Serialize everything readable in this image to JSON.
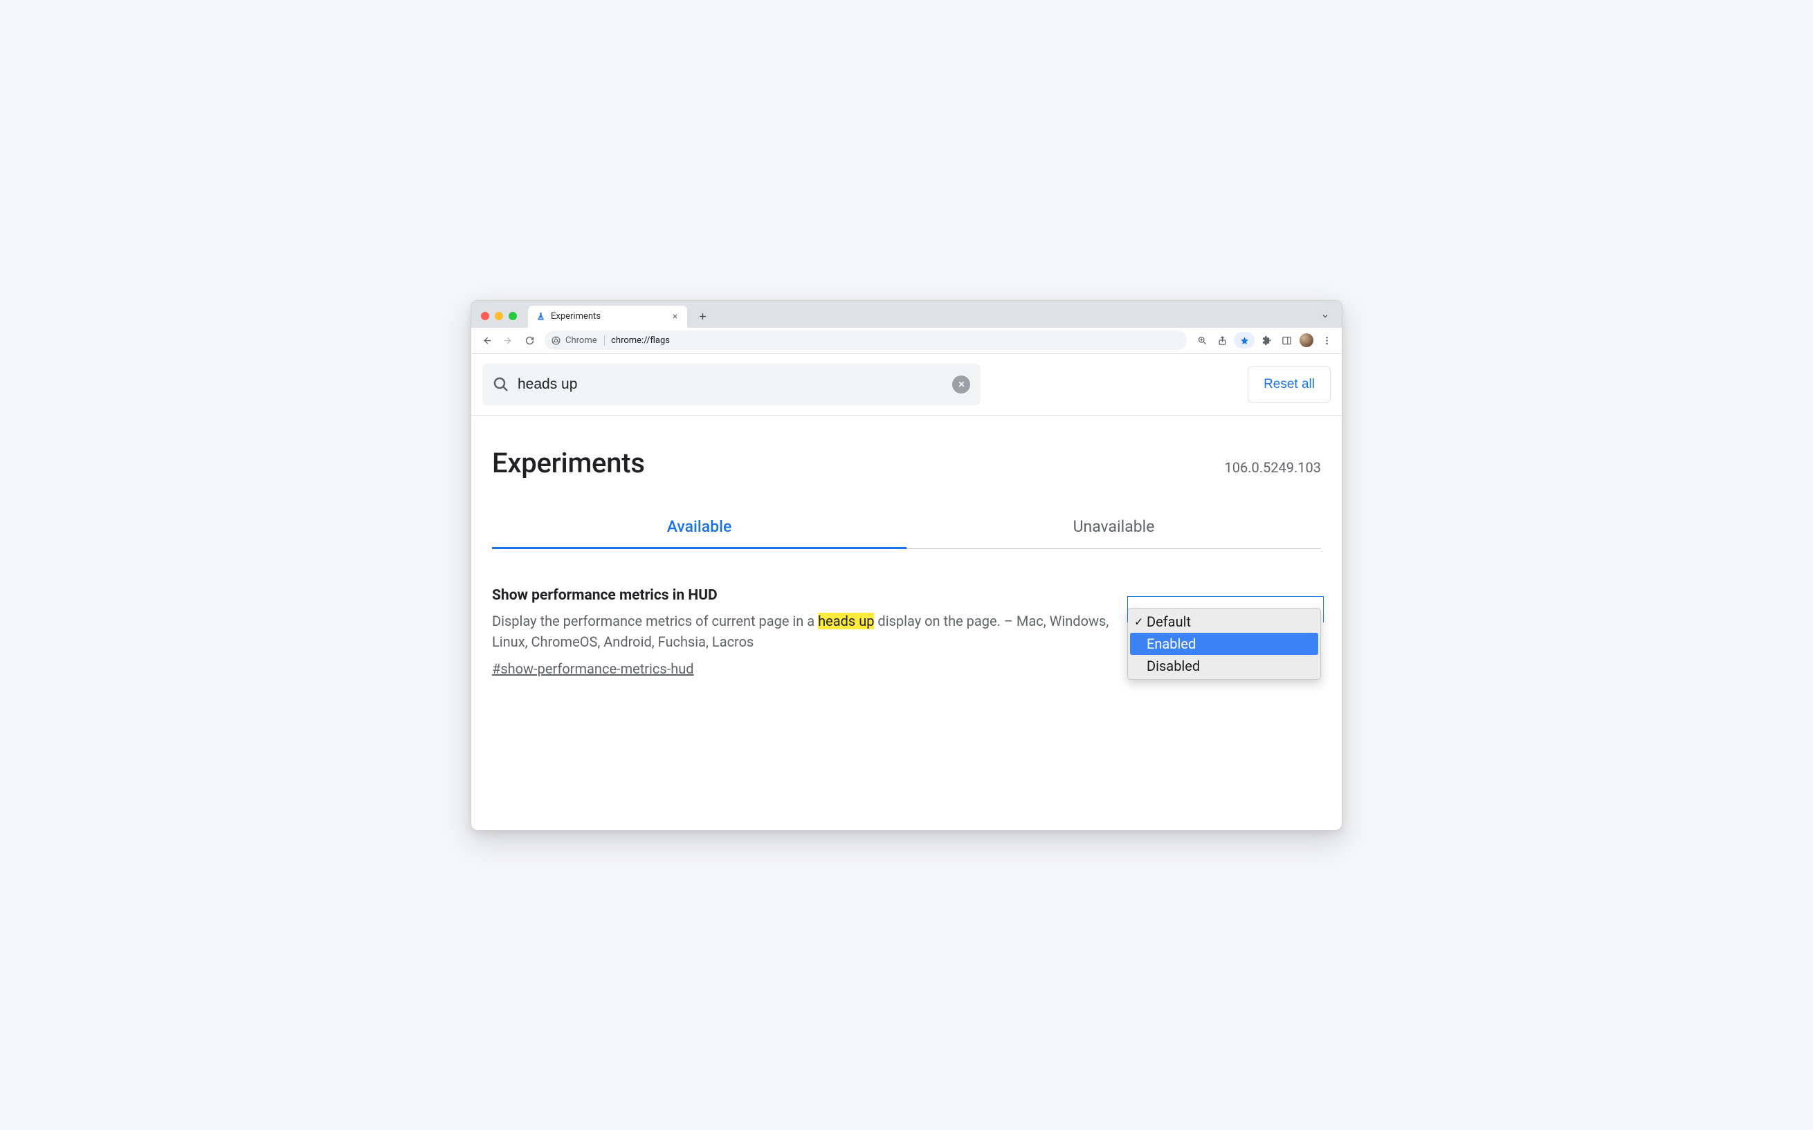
{
  "browser": {
    "tab_title": "Experiments",
    "omnibox": {
      "host": "Chrome",
      "path": "chrome://flags"
    }
  },
  "search": {
    "query": "heads up",
    "reset_label": "Reset all"
  },
  "header": {
    "title": "Experiments",
    "version": "106.0.5249.103"
  },
  "tabs": {
    "available": "Available",
    "unavailable": "Unavailable"
  },
  "flag": {
    "title": "Show performance metrics in HUD",
    "desc_before": "Display the performance metrics of current page in a ",
    "desc_highlight": "heads up",
    "desc_after": " display on the page. – Mac, Windows, Linux, ChromeOS, Android, Fuchsia, Lacros",
    "link": "#show-performance-metrics-hud",
    "options": {
      "default": "Default",
      "enabled": "Enabled",
      "disabled": "Disabled"
    }
  }
}
